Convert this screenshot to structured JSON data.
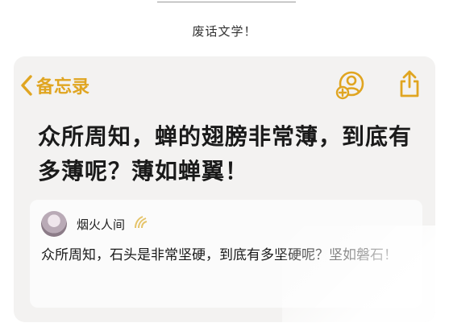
{
  "caption": "废话文学！",
  "nav": {
    "back_label": "备忘录",
    "back_icon": "chevron-left-icon",
    "share_person_icon": "add-person-icon",
    "share_icon": "share-icon",
    "accent_color": "#e0a521"
  },
  "note": {
    "title": "众所周知，蝉的翅膀非常薄，到底有多薄呢？薄如蝉翼！"
  },
  "comment": {
    "username": "烟火人间",
    "body": "众所周知，石头是非常坚硬，到底有多坚硬呢？坚如磐石！"
  }
}
